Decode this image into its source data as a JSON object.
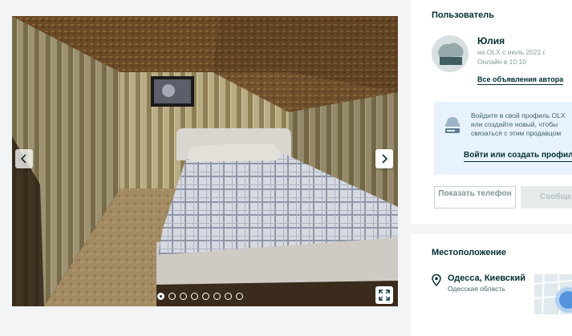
{
  "gallery": {
    "image_count": 8,
    "active_index": 0,
    "icons": {
      "prev": "chevron-left-icon",
      "next": "chevron-right-icon",
      "fullscreen": "fullscreen-icon"
    }
  },
  "user": {
    "section_title": "Пользователь",
    "name": "Юлия",
    "member_since": "на OLX с июль 2021 г.",
    "online_status": "Онлайн в 10:10",
    "all_ads_link": "Все объявления автора"
  },
  "login_prompt": {
    "text": "Войдите в свой профиль OLX или создайте новый, чтобы связаться с этим продавцом",
    "link": "Войти или создать профиль"
  },
  "buttons": {
    "show_phone": "Показать телефон",
    "message": "Сообщение"
  },
  "location": {
    "section_title": "Местоположение",
    "city": "Одесса, Киевский",
    "region": "Одесская область"
  },
  "colors": {
    "text_primary": "#002f34",
    "login_box_bg": "#e8f2fc",
    "page_bg": "#f2f4f5"
  }
}
